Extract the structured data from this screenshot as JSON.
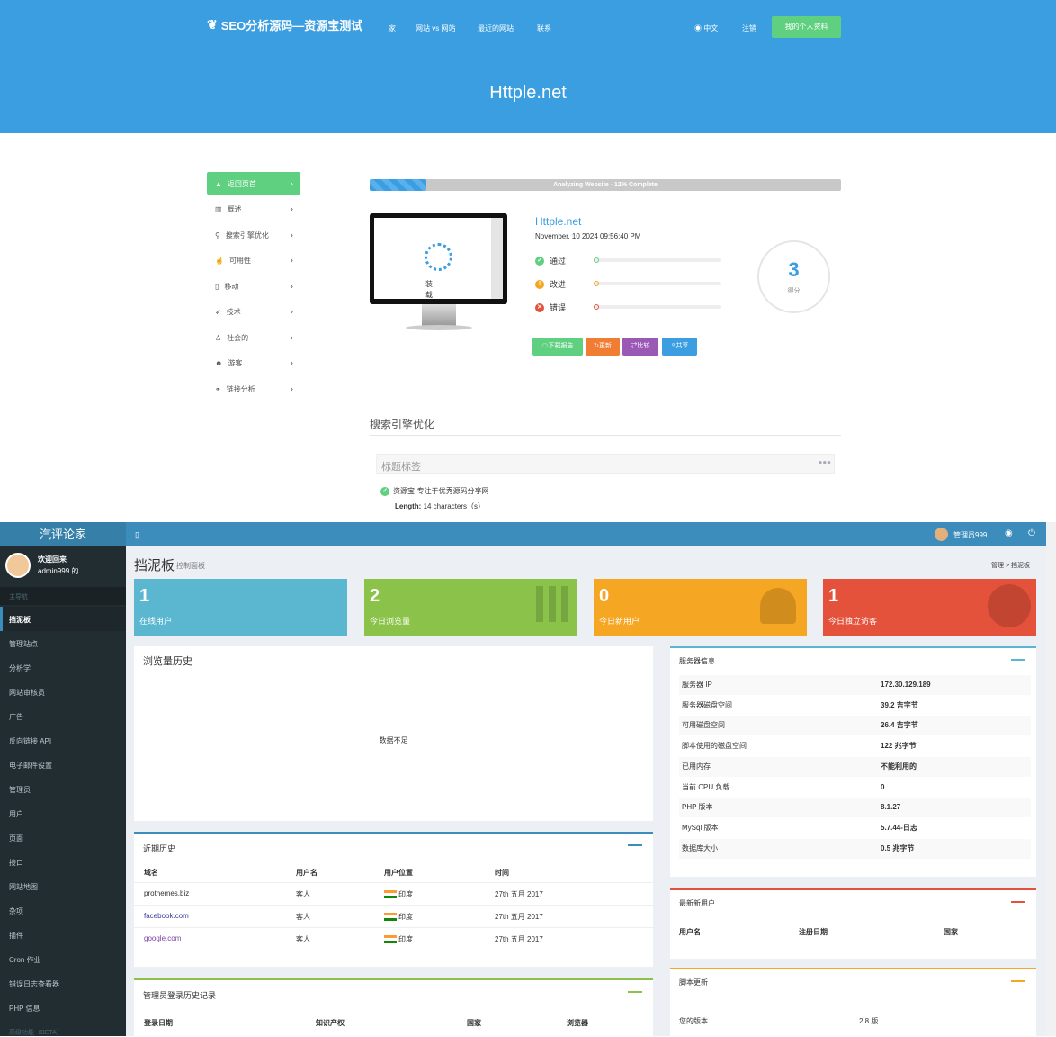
{
  "top": {
    "logo": "SEO分析源码—资源宝测试",
    "nav": [
      "家",
      "网站 vs 网站",
      "最近的网站",
      "联系"
    ],
    "lang": "中文",
    "logout": "注销",
    "profile": "我的个人资料",
    "hero": "Httple.net"
  },
  "sidebar": {
    "items": [
      {
        "label": "返回页首",
        "icon": "chevron-up-icon"
      },
      {
        "label": "概述",
        "icon": "bar-chart-icon"
      },
      {
        "label": "搜索引擎优化",
        "icon": "search-icon"
      },
      {
        "label": "可用性",
        "icon": "pointer-icon"
      },
      {
        "label": "移动",
        "icon": "mobile-icon"
      },
      {
        "label": "技术",
        "icon": "rocket-icon"
      },
      {
        "label": "社会的",
        "icon": "thumbs-up-icon"
      },
      {
        "label": "游客",
        "icon": "users-icon"
      },
      {
        "label": "链接分析",
        "icon": "link-icon"
      }
    ]
  },
  "analysis": {
    "progress_text": "Analyzing Website - 12% Complete",
    "progress": 0.12,
    "loading": "装载",
    "site": "Httple.net",
    "date": "November, 10 2024 09:56:40 PM",
    "pass": "通过",
    "improve": "改进",
    "error": "错误",
    "score": "3",
    "score_label": "得分",
    "buttons": [
      "下载报告",
      "更新",
      "比较",
      "共享"
    ],
    "seo_title": "搜索引擎优化",
    "tag_title": "标题标签",
    "tag_value": "资源宝-专注于优秀源码分享网",
    "length_label": "Length:",
    "length_value": "14 characters（s）"
  },
  "admin": {
    "brand": "汽评论家",
    "user": "管理员999",
    "welcome": "欢迎回来",
    "username": "admin999 的",
    "nav_header": "主导航",
    "menu": [
      "挡泥板",
      "管理站点",
      "分析学",
      "网站审核员",
      "广告",
      "反向链接 API",
      "电子邮件设置",
      "管理员",
      "用户",
      "页面",
      "接口",
      "网站地图",
      "杂项",
      "插件",
      "Cron 作业",
      "错误日志查看器",
      "PHP 信息",
      "高级功能（BETA）"
    ],
    "page_title": "挡泥板",
    "page_sub": "控制面板",
    "breadcrumb": [
      "管理",
      "挡泥板"
    ],
    "stats": [
      {
        "n": "1",
        "label": "在线用户",
        "color": "#5ab7cf"
      },
      {
        "n": "2",
        "label": "今日浏览量",
        "color": "#8bc34a"
      },
      {
        "n": "0",
        "label": "今日新用户",
        "color": "#f5a623"
      },
      {
        "n": "1",
        "label": "今日独立访客",
        "color": "#e4523b"
      }
    ],
    "views_title": "浏览量历史",
    "no_data": "数据不足",
    "recent_title": "近期历史",
    "recent_headers": [
      "域名",
      "用户名",
      "用户位置",
      "时间"
    ],
    "recent_rows": [
      [
        "prothemes.biz",
        "客人",
        "印度",
        "27th 五月 2017"
      ],
      [
        "facebook.com",
        "客人",
        "印度",
        "27th 五月 2017"
      ],
      [
        "google.com",
        "客人",
        "印度",
        "27th 五月 2017"
      ]
    ],
    "login_title": "管理员登录历史记录",
    "login_headers": [
      "登录日期",
      "知识产权",
      "国家",
      "浏览器"
    ],
    "server_title": "服务器信息",
    "server_rows": [
      [
        "服务器 IP",
        "172.30.129.189"
      ],
      [
        "服务器磁盘空间",
        "39.2 吉字节"
      ],
      [
        "可用磁盘空间",
        "26.4 吉字节"
      ],
      [
        "脚本使用的磁盘空间",
        "122 兆字节"
      ],
      [
        "已用内存",
        "不能利用的"
      ],
      [
        "当前 CPU 负载",
        "0"
      ],
      [
        "PHP 版本",
        "8.1.27"
      ],
      [
        "MySql 版本",
        "5.7.44-日志"
      ],
      [
        "数据库大小",
        "0.5 兆字节"
      ]
    ],
    "newusers_title": "最新新用户",
    "newusers_headers": [
      "用户名",
      "注册日期",
      "国家"
    ],
    "update_title": "脚本更新",
    "version_label": "您的版本",
    "version_value": "2.8 版"
  }
}
